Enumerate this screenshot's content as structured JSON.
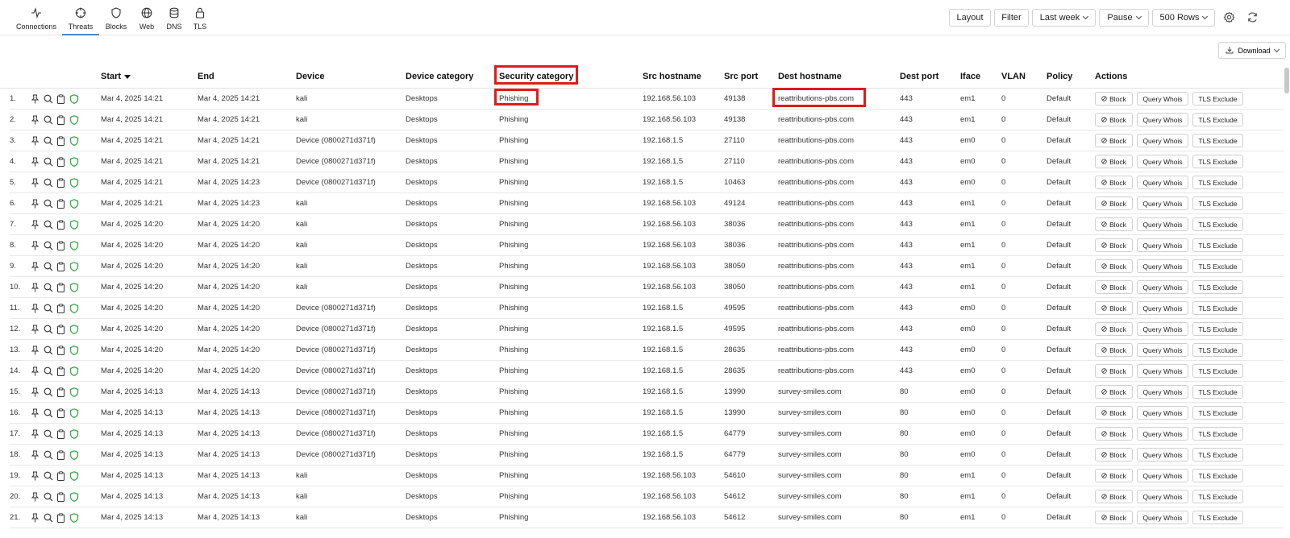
{
  "nav": {
    "tabs": [
      {
        "label": "Connections",
        "icon": "activity-icon"
      },
      {
        "label": "Threats",
        "icon": "crosshair-icon",
        "active": true
      },
      {
        "label": "Blocks",
        "icon": "shield-icon"
      },
      {
        "label": "Web",
        "icon": "globe-icon"
      },
      {
        "label": "DNS",
        "icon": "database-icon"
      },
      {
        "label": "TLS",
        "icon": "lock-icon"
      }
    ]
  },
  "toolbar": {
    "layout": "Layout",
    "filter": "Filter",
    "range": "Last week",
    "pause": "Pause",
    "rows": "500 Rows",
    "settings_icon": "gear-icon",
    "refresh_icon": "refresh-icon"
  },
  "download": "Download",
  "columns": {
    "start": "Start",
    "end": "End",
    "device": "Device",
    "device_category": "Device category",
    "security_category": "Security category",
    "src_hostname": "Src hostname",
    "src_port": "Src port",
    "dest_hostname": "Dest hostname",
    "dest_port": "Dest port",
    "iface": "Iface",
    "vlan": "VLAN",
    "policy": "Policy",
    "actions": "Actions"
  },
  "actions": {
    "block": "Block",
    "whois": "Query Whois",
    "tls": "TLS Exclude"
  },
  "colors": {
    "highlight": "#e01b1b",
    "shield": "#3aa84a",
    "accent": "#4a86c8"
  },
  "rows": [
    {
      "n": "1.",
      "start": "Mar 4, 2025 14:21",
      "end": "Mar 4, 2025 14:21",
      "device": "kali",
      "devcat": "Desktops",
      "seccat": "Phishing",
      "src": "192.168.56.103",
      "sport": "49138",
      "dest": "reattributions-pbs.com",
      "dport": "443",
      "iface": "em1",
      "vlan": "0",
      "policy": "Default"
    },
    {
      "n": "2.",
      "start": "Mar 4, 2025 14:21",
      "end": "Mar 4, 2025 14:21",
      "device": "kali",
      "devcat": "Desktops",
      "seccat": "Phishing",
      "src": "192.168.56.103",
      "sport": "49138",
      "dest": "reattributions-pbs.com",
      "dport": "443",
      "iface": "em1",
      "vlan": "0",
      "policy": "Default"
    },
    {
      "n": "3.",
      "start": "Mar 4, 2025 14:21",
      "end": "Mar 4, 2025 14:21",
      "device": "Device (0800271d371f)",
      "devcat": "Desktops",
      "seccat": "Phishing",
      "src": "192.168.1.5",
      "sport": "27110",
      "dest": "reattributions-pbs.com",
      "dport": "443",
      "iface": "em0",
      "vlan": "0",
      "policy": "Default"
    },
    {
      "n": "4.",
      "start": "Mar 4, 2025 14:21",
      "end": "Mar 4, 2025 14:21",
      "device": "Device (0800271d371f)",
      "devcat": "Desktops",
      "seccat": "Phishing",
      "src": "192.168.1.5",
      "sport": "27110",
      "dest": "reattributions-pbs.com",
      "dport": "443",
      "iface": "em0",
      "vlan": "0",
      "policy": "Default"
    },
    {
      "n": "5.",
      "start": "Mar 4, 2025 14:21",
      "end": "Mar 4, 2025 14:23",
      "device": "Device (0800271d371f)",
      "devcat": "Desktops",
      "seccat": "Phishing",
      "src": "192.168.1.5",
      "sport": "10463",
      "dest": "reattributions-pbs.com",
      "dport": "443",
      "iface": "em0",
      "vlan": "0",
      "policy": "Default"
    },
    {
      "n": "6.",
      "start": "Mar 4, 2025 14:21",
      "end": "Mar 4, 2025 14:23",
      "device": "kali",
      "devcat": "Desktops",
      "seccat": "Phishing",
      "src": "192.168.56.103",
      "sport": "49124",
      "dest": "reattributions-pbs.com",
      "dport": "443",
      "iface": "em1",
      "vlan": "0",
      "policy": "Default"
    },
    {
      "n": "7.",
      "start": "Mar 4, 2025 14:20",
      "end": "Mar 4, 2025 14:20",
      "device": "kali",
      "devcat": "Desktops",
      "seccat": "Phishing",
      "src": "192.168.56.103",
      "sport": "38036",
      "dest": "reattributions-pbs.com",
      "dport": "443",
      "iface": "em1",
      "vlan": "0",
      "policy": "Default"
    },
    {
      "n": "8.",
      "start": "Mar 4, 2025 14:20",
      "end": "Mar 4, 2025 14:20",
      "device": "kali",
      "devcat": "Desktops",
      "seccat": "Phishing",
      "src": "192.168.56.103",
      "sport": "38036",
      "dest": "reattributions-pbs.com",
      "dport": "443",
      "iface": "em1",
      "vlan": "0",
      "policy": "Default"
    },
    {
      "n": "9.",
      "start": "Mar 4, 2025 14:20",
      "end": "Mar 4, 2025 14:20",
      "device": "kali",
      "devcat": "Desktops",
      "seccat": "Phishing",
      "src": "192.168.56.103",
      "sport": "38050",
      "dest": "reattributions-pbs.com",
      "dport": "443",
      "iface": "em1",
      "vlan": "0",
      "policy": "Default"
    },
    {
      "n": "10.",
      "start": "Mar 4, 2025 14:20",
      "end": "Mar 4, 2025 14:20",
      "device": "kali",
      "devcat": "Desktops",
      "seccat": "Phishing",
      "src": "192.168.56.103",
      "sport": "38050",
      "dest": "reattributions-pbs.com",
      "dport": "443",
      "iface": "em1",
      "vlan": "0",
      "policy": "Default"
    },
    {
      "n": "11.",
      "start": "Mar 4, 2025 14:20",
      "end": "Mar 4, 2025 14:20",
      "device": "Device (0800271d371f)",
      "devcat": "Desktops",
      "seccat": "Phishing",
      "src": "192.168.1.5",
      "sport": "49595",
      "dest": "reattributions-pbs.com",
      "dport": "443",
      "iface": "em0",
      "vlan": "0",
      "policy": "Default"
    },
    {
      "n": "12.",
      "start": "Mar 4, 2025 14:20",
      "end": "Mar 4, 2025 14:20",
      "device": "Device (0800271d371f)",
      "devcat": "Desktops",
      "seccat": "Phishing",
      "src": "192.168.1.5",
      "sport": "49595",
      "dest": "reattributions-pbs.com",
      "dport": "443",
      "iface": "em0",
      "vlan": "0",
      "policy": "Default"
    },
    {
      "n": "13.",
      "start": "Mar 4, 2025 14:20",
      "end": "Mar 4, 2025 14:20",
      "device": "Device (0800271d371f)",
      "devcat": "Desktops",
      "seccat": "Phishing",
      "src": "192.168.1.5",
      "sport": "28635",
      "dest": "reattributions-pbs.com",
      "dport": "443",
      "iface": "em0",
      "vlan": "0",
      "policy": "Default"
    },
    {
      "n": "14.",
      "start": "Mar 4, 2025 14:20",
      "end": "Mar 4, 2025 14:20",
      "device": "Device (0800271d371f)",
      "devcat": "Desktops",
      "seccat": "Phishing",
      "src": "192.168.1.5",
      "sport": "28635",
      "dest": "reattributions-pbs.com",
      "dport": "443",
      "iface": "em0",
      "vlan": "0",
      "policy": "Default"
    },
    {
      "n": "15.",
      "start": "Mar 4, 2025 14:13",
      "end": "Mar 4, 2025 14:13",
      "device": "Device (0800271d371f)",
      "devcat": "Desktops",
      "seccat": "Phishing",
      "src": "192.168.1.5",
      "sport": "13990",
      "dest": "survey-smiles.com",
      "dport": "80",
      "iface": "em0",
      "vlan": "0",
      "policy": "Default"
    },
    {
      "n": "16.",
      "start": "Mar 4, 2025 14:13",
      "end": "Mar 4, 2025 14:13",
      "device": "Device (0800271d371f)",
      "devcat": "Desktops",
      "seccat": "Phishing",
      "src": "192.168.1.5",
      "sport": "13990",
      "dest": "survey-smiles.com",
      "dport": "80",
      "iface": "em0",
      "vlan": "0",
      "policy": "Default"
    },
    {
      "n": "17.",
      "start": "Mar 4, 2025 14:13",
      "end": "Mar 4, 2025 14:13",
      "device": "Device (0800271d371f)",
      "devcat": "Desktops",
      "seccat": "Phishing",
      "src": "192.168.1.5",
      "sport": "64779",
      "dest": "survey-smiles.com",
      "dport": "80",
      "iface": "em0",
      "vlan": "0",
      "policy": "Default"
    },
    {
      "n": "18.",
      "start": "Mar 4, 2025 14:13",
      "end": "Mar 4, 2025 14:13",
      "device": "Device (0800271d371f)",
      "devcat": "Desktops",
      "seccat": "Phishing",
      "src": "192.168.1.5",
      "sport": "64779",
      "dest": "survey-smiles.com",
      "dport": "80",
      "iface": "em0",
      "vlan": "0",
      "policy": "Default"
    },
    {
      "n": "19.",
      "start": "Mar 4, 2025 14:13",
      "end": "Mar 4, 2025 14:13",
      "device": "kali",
      "devcat": "Desktops",
      "seccat": "Phishing",
      "src": "192.168.56.103",
      "sport": "54610",
      "dest": "survey-smiles.com",
      "dport": "80",
      "iface": "em1",
      "vlan": "0",
      "policy": "Default"
    },
    {
      "n": "20.",
      "start": "Mar 4, 2025 14:13",
      "end": "Mar 4, 2025 14:13",
      "device": "kali",
      "devcat": "Desktops",
      "seccat": "Phishing",
      "src": "192.168.56.103",
      "sport": "54612",
      "dest": "survey-smiles.com",
      "dport": "80",
      "iface": "em1",
      "vlan": "0",
      "policy": "Default"
    },
    {
      "n": "21.",
      "start": "Mar 4, 2025 14:13",
      "end": "Mar 4, 2025 14:13",
      "device": "kali",
      "devcat": "Desktops",
      "seccat": "Phishing",
      "src": "192.168.56.103",
      "sport": "54612",
      "dest": "survey-smiles.com",
      "dport": "80",
      "iface": "em1",
      "vlan": "0",
      "policy": "Default"
    }
  ]
}
